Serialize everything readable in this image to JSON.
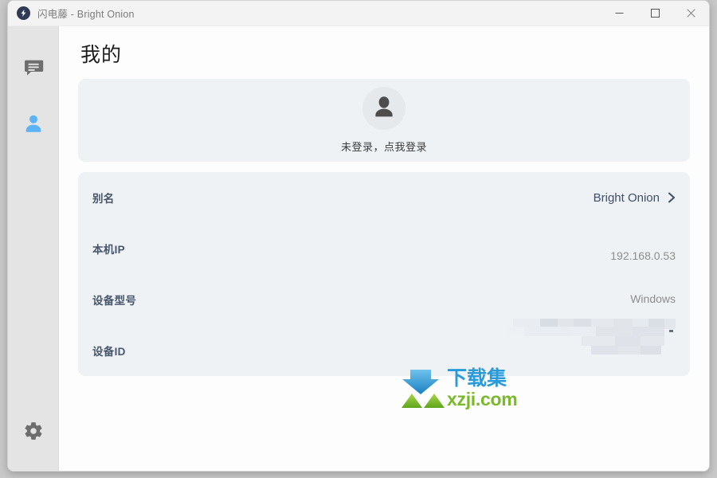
{
  "window": {
    "app_icon": "lightning-bolt-icon",
    "title": "闪电藤 - Bright Onion",
    "controls": {
      "minimize": "minimize-icon",
      "maximize": "maximize-icon",
      "close": "close-icon"
    }
  },
  "sidebar": {
    "items": [
      {
        "id": "chat",
        "icon": "chat-bubble-icon",
        "active": false,
        "color": "#6e6e6e"
      },
      {
        "id": "profile",
        "icon": "person-icon",
        "active": true,
        "color": "#5cb3f5"
      },
      {
        "id": "settings",
        "icon": "gear-icon",
        "active": false,
        "color": "#6e6e6e"
      }
    ]
  },
  "main": {
    "page_title": "我的",
    "account_card": {
      "avatar_icon": "person-silhouette-icon",
      "login_prompt": "未登录，点我登录"
    },
    "info_rows": [
      {
        "label": "别名",
        "value": "Bright Onion",
        "chevron": true
      },
      {
        "label": "本机IP",
        "value": "192.168.0.53",
        "chevron": false
      },
      {
        "label": "设备型号",
        "value": "Windows",
        "chevron": false
      },
      {
        "label": "设备ID",
        "value": "",
        "redacted": true,
        "chevron": false
      }
    ]
  },
  "watermark": {
    "cn_text": "下载集",
    "en_text": "xzji.com",
    "cn_color": "#2a9bd8",
    "en_color": "#7ab929",
    "mark_icon": "download-arrow-logo"
  },
  "colors": {
    "accent": "#5cb3f5",
    "card_bg": "#eef2f5",
    "sidebar_bg": "#e4e4e4",
    "label": "#47566b",
    "value": "#8d8d8d"
  }
}
